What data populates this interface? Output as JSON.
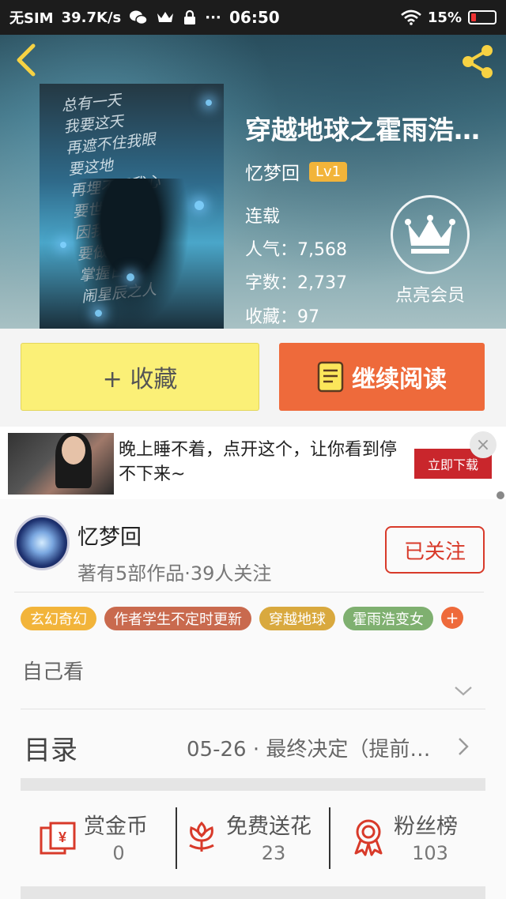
{
  "status_bar": {
    "carrier": "无SIM",
    "speed": "39.7K/s",
    "time": "06:50",
    "battery": "15%",
    "battery_level": 0.15
  },
  "book": {
    "title": "穿越地球之霍雨浩…",
    "author": "忆梦回",
    "level": "Lv1",
    "status": "连载",
    "popularity": "人气：7,568",
    "word_count": "字数：2,737",
    "favorites": "收藏：97",
    "cover_poem": "总有一天\n我要这天\n再遮不住我眼\n要这地\n再埋不了我心\n要世间一切\n因我而臣服\n要做那\n掌握日月\n闹星辰之人"
  },
  "vip": {
    "label": "点亮会员"
  },
  "actions": {
    "collect_label": "+ 收藏",
    "read_label": "继续阅读"
  },
  "ad": {
    "text": "晚上睡不着，点开这个，让你看到停不下来~",
    "cta": "立即下载",
    "close": "×"
  },
  "author_card": {
    "name": "忆梦回",
    "stats": "著有5部作品·39人关注",
    "follow_label": "已关注"
  },
  "tags": [
    {
      "label": "玄幻奇幻",
      "color": "#f2b43a"
    },
    {
      "label": "作者学生不定时更新",
      "color": "#c96a4e"
    },
    {
      "label": "穿越地球",
      "color": "#d9a93e"
    },
    {
      "label": "霍雨浩变女",
      "color": "#7fb070"
    }
  ],
  "tag_more": "+",
  "description": "自己看",
  "toc": {
    "label": "目录",
    "latest": "05-26 · 最终决定（提前…"
  },
  "stats": [
    {
      "label": "赏金币",
      "value": "0",
      "icon": "gold-coin-envelope-icon"
    },
    {
      "label": "免费送花",
      "value": "23",
      "icon": "flower-icon"
    },
    {
      "label": "粉丝榜",
      "value": "103",
      "icon": "medal-icon"
    }
  ],
  "colors": {
    "accent": "#ee6a3b",
    "collect_bg": "#fbf077",
    "follow": "#d83a2a",
    "icon_red": "#d83a2a"
  }
}
